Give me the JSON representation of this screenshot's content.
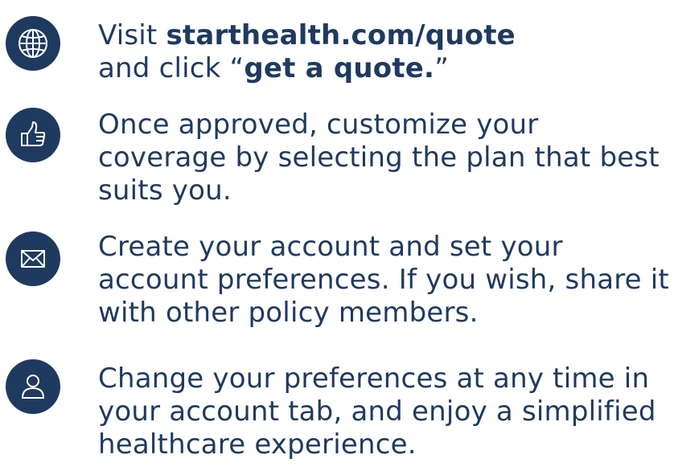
{
  "steps": [
    {
      "icon": "globe-icon",
      "line1_prefix": "Visit ",
      "line1_link": "starthealth.com/quote",
      "line2_prefix": "and click “",
      "line2_bold": "get a quote.",
      "line2_suffix": "”"
    },
    {
      "icon": "thumbs-up-icon",
      "text": "Once approved, customize your coverage by selecting the plan that best suits you."
    },
    {
      "icon": "envelope-icon",
      "text": "Create your account and set your account preferences. If you wish, share it with other policy members."
    },
    {
      "icon": "user-icon",
      "text": "Change your preferences at any time in your account tab, and enjoy a simplified healthcare experience."
    }
  ],
  "colors": {
    "accent": "#1f3a5f",
    "background": "#ffffff"
  }
}
